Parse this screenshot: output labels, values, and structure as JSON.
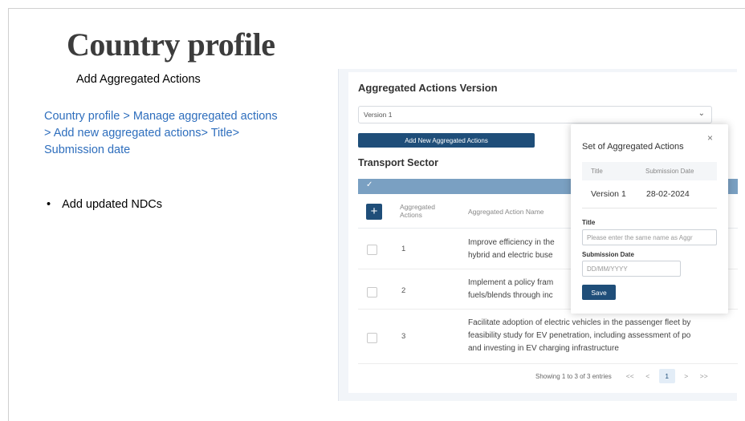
{
  "slide": {
    "title": "Country profile",
    "subtitle": "Add Aggregated Actions",
    "breadcrumb": "Country profile > Manage aggregated actions > Add new aggregated actions> Title> Submission date",
    "bullets": [
      "Add updated NDCs"
    ]
  },
  "app": {
    "card_title": "Aggregated Actions Version",
    "version_select": {
      "value": "Version 1"
    },
    "add_button_label": "Add New Aggregated Actions",
    "sector_title": "Transport Sector",
    "table": {
      "columns": [
        "Aggregated Actions",
        "Aggregated Action Name"
      ],
      "rows": [
        {
          "num": "1",
          "lines": [
            "Improve efficiency in the",
            "hybrid and electric buse"
          ]
        },
        {
          "num": "2",
          "lines": [
            "Implement a policy fram",
            "fuels/blends through inc"
          ]
        },
        {
          "num": "3",
          "lines": [
            "Facilitate adoption of electric vehicles in the passenger fleet by",
            "feasibility study for EV penetration, including assessment of po",
            "and investing in EV charging infrastructure"
          ]
        }
      ]
    },
    "pagination": {
      "info": "Showing 1 to 3 of 3 entries",
      "first": "<<",
      "prev": "<",
      "current": "1",
      "next": ">",
      "last": ">>"
    }
  },
  "modal": {
    "title": "Set of Aggregated Actions",
    "close": "×",
    "table": {
      "headers": [
        "Title",
        "Submission Date"
      ],
      "rows": [
        {
          "title": "Version 1",
          "date": "28-02-2024"
        }
      ]
    },
    "title_label": "Title",
    "title_placeholder": "Please enter the same name as Aggr",
    "date_label": "Submission Date",
    "date_placeholder": "DD/MM/YYYY",
    "save_label": "Save"
  },
  "colors": {
    "primary": "#1f4e79",
    "table_strip": "#7aa0c2",
    "link": "#2e6ebd"
  },
  "icons": {
    "select_chevron": "chevron-down-icon",
    "strip_check": "check-icon",
    "add_row": "plus-icon"
  }
}
